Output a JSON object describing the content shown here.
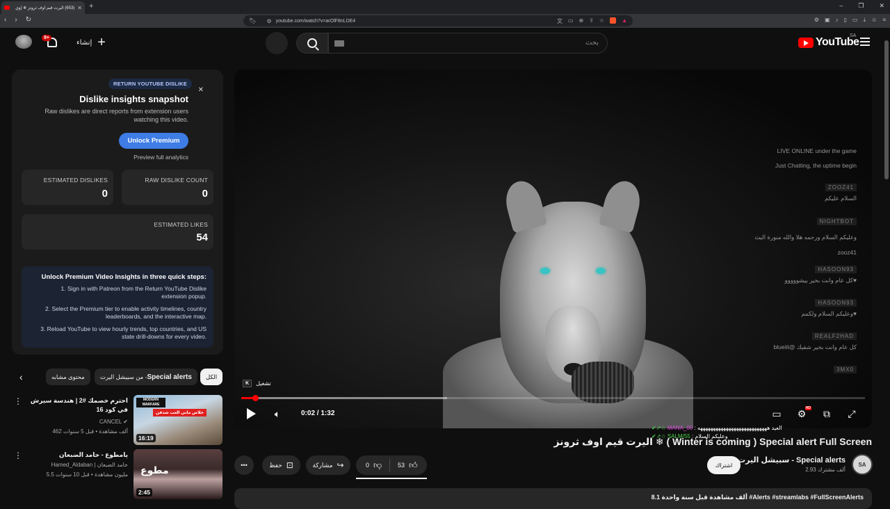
{
  "browser": {
    "tab_title": "(653) اليرت قيم اوف ثرونز ❄ (وي",
    "url": "youtube.com/watch?v=arOlF8nLDE4"
  },
  "header": {
    "logo": "YouTube",
    "country": "SA",
    "search_placeholder": "بحث",
    "create_label": "إنشاء",
    "notif_count": "9+"
  },
  "dislike_panel": {
    "badge": "RETURN YOUTUBE DISLIKE",
    "title": "Dislike insights snapshot",
    "desc": "Raw dislikes are direct reports from extension users watching this video.",
    "unlock_label": "Unlock Premium",
    "preview_label": "Preview full analytics",
    "stats": {
      "estimated_dislikes_label": "ESTIMATED DISLIKES",
      "estimated_dislikes": "0",
      "raw_dislike_label": "RAW DISLIKE COUNT",
      "raw_dislike": "0",
      "estimated_likes_label": "ESTIMATED LIKES",
      "estimated_likes": "54"
    },
    "steps_title": "Unlock Premium Video Insights in three quick steps:",
    "steps": [
      "1. Sign in with Patreon from the Return YouTube Dislike extension popup.",
      "2. Select the Premium tier to enable activity timelines, country leaderboards, and the interactive map.",
      "3. Reload YouTube to view hourly trends, top countries, and US state drill-downs for every video."
    ]
  },
  "chips": {
    "all": "الكل",
    "from_channel_prefix": "من سبيشل اليرت - ",
    "from_channel_bold": "Special alerts",
    "related": "محتوى مشابه"
  },
  "recommendations": [
    {
      "title": "احترم خصمك #2 | هندسة سيرش في كود 16",
      "channel": "CANCEL",
      "meta": "462 ألف مشاهدة • قبل 5 سنوات",
      "duration": "16:19",
      "thumb_text_1": "MODERN WARFARE",
      "thumb_text_2": "خلاص مابي العب شدفن"
    },
    {
      "title": "يامطوع - حامد الضبعان",
      "channel": "Hamed_Aldaban | حامد الضبعان",
      "meta": "5.5 مليون مشاهدة • قبل 10 سنوات",
      "duration": "2:45",
      "thumb_text_1": "مطوع"
    }
  ],
  "player": {
    "tooltip": "تشغيل",
    "tooltip_key": "K",
    "time_current": "0:02",
    "time_total": "1:32",
    "progress": 0.022,
    "buffered": 0.33,
    "chat": {
      "header_1": "LIVE ONLINE under the game",
      "header_2": "Just Chatting, the uptime begin",
      "entries": [
        {
          "user": "ZOOZ41",
          "msg": "السلام عليكم"
        },
        {
          "user": "NIGHTBOT",
          "msg": "وعليكم السلام ورحمه هلا والله منورة البث zooz41"
        },
        {
          "user": "HASOON93",
          "msg": "كل عام وانت بخير بيشووووو♥"
        },
        {
          "user": "HASOON93",
          "msg": "وعليكم السلام ولكمم♥"
        },
        {
          "user": "REALF2HAD",
          "msg": "blueiit@ كل عام وانت بخير شفيك"
        },
        {
          "user": "3MX0",
          "msg": ""
        }
      ]
    },
    "overlay_line_1_user": "MANA_00",
    "overlay_line_1": "العيد هههههههههههههههههههههههههههه",
    "overlay_line_2_user": "SALM/55",
    "overlay_line_2": "وعليكم السلام"
  },
  "video": {
    "title": "اليرت قيم اوف ثرونز ❄ ( Winter is coming ) Special alert Full Screen",
    "channel": "سبيشل اليرت - Special alerts",
    "subs": "2.93 ألف مشترك",
    "subscribe_label": "اشتراك",
    "likes": "53",
    "dislikes": "0",
    "share_label": "مشاركة",
    "save_label": "حفظ",
    "description_line": "8.1 ألف مشاهدة قبل سنة واحدة #Alerts #streamlabs #FullScreenAlerts",
    "channel_avatar_text": "SA"
  }
}
